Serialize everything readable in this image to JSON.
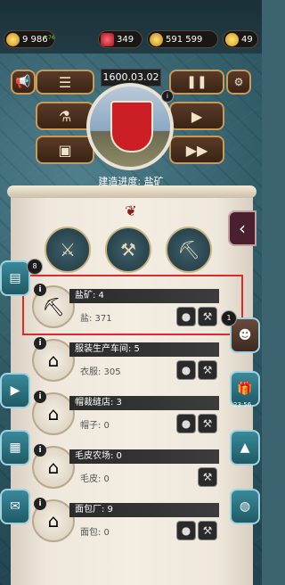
{
  "resources": {
    "coins": "9 986",
    "coins_rate": "+76",
    "rubies": "349",
    "money": "591 599",
    "stars": "49"
  },
  "header": {
    "date": "1600.03.02",
    "build_progress": "建造进度: 盐矿"
  },
  "buildings": [
    {
      "name": "盐矿: 4",
      "product": "盐: 371",
      "icon": "salt-mine-icon"
    },
    {
      "name": "服装生产车间: 5",
      "product": "衣服: 305",
      "icon": "clothing-workshop-icon"
    },
    {
      "name": "帽裁缝店: 3",
      "product": "帽子: 0",
      "icon": "hat-shop-icon"
    },
    {
      "name": "毛皮农场: 0",
      "product": "毛皮: 0",
      "icon": "fur-farm-icon"
    },
    {
      "name": "面包厂: 9",
      "product": "面包: 0",
      "icon": "bakery-icon"
    }
  ],
  "side": {
    "left_badge": "8",
    "right_badge": "1",
    "timer": "23:56"
  },
  "colors": {
    "highlight": "#e5262b",
    "crest_red": "#cc1e25"
  }
}
